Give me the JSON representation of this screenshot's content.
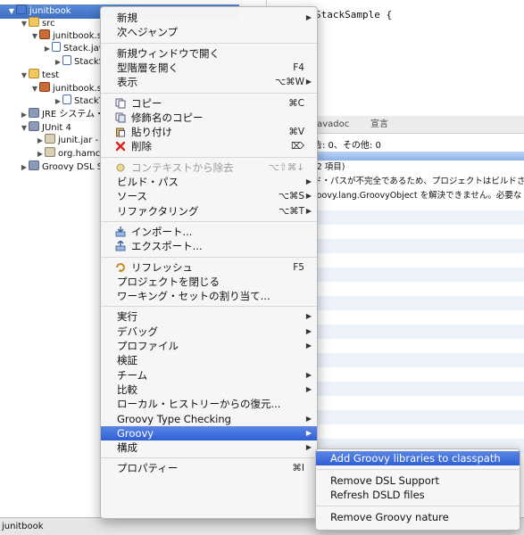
{
  "tree": [
    {
      "label": "junitbook",
      "icon": "project-icon",
      "twisty": "▼",
      "selected": true
    },
    {
      "label": "src",
      "icon": "source-folder-icon",
      "twisty": "▼"
    },
    {
      "label": "junitbook.s",
      "icon": "package-icon",
      "twisty": "▼"
    },
    {
      "label": "Stack.jav",
      "icon": "java-file-icon",
      "twisty": "▶"
    },
    {
      "label": "StackSar",
      "icon": "java-file-icon",
      "twisty": "▶"
    },
    {
      "label": "test",
      "icon": "source-folder-icon",
      "twisty": "▼"
    },
    {
      "label": "junitbook.s",
      "icon": "package-icon",
      "twisty": "▼"
    },
    {
      "label": "StackTe",
      "icon": "java-file-icon",
      "twisty": "▶"
    },
    {
      "label": "JRE システム・",
      "icon": "library-icon",
      "twisty": "▶"
    },
    {
      "label": "JUnit 4",
      "icon": "library-icon",
      "twisty": "▼"
    },
    {
      "label": "junit.jar - /",
      "icon": "jar-icon",
      "twisty": "▶"
    },
    {
      "label": "org.hamcre",
      "icon": "jar-icon",
      "twisty": "▶"
    },
    {
      "label": "Groovy DSL Su",
      "icon": "library-icon",
      "twisty": "▶"
    }
  ],
  "editor": {
    "code": "StackSample {"
  },
  "views": {
    "tabs": [
      "@ Javadoc",
      "宣言"
    ],
    "counts": "告: 0、その他: 0",
    "rows": [
      "(2 項目)",
      "ド・パスが不完全であるため、プロジェクトはビルドさ",
      "roovy.lang.GroovyObject を解決できません。必要な ."
    ]
  },
  "status": "junitbook",
  "context_menu": [
    {
      "type": "item",
      "label": "新規",
      "submenu": true
    },
    {
      "type": "item",
      "label": "次へジャンプ"
    },
    {
      "type": "sep"
    },
    {
      "type": "item",
      "label": "新規ウィンドウで開く"
    },
    {
      "type": "item",
      "label": "型階層を開く",
      "shortcut": "F4"
    },
    {
      "type": "item",
      "label": "表示",
      "shortcut": "⌥⌘W",
      "submenu": true
    },
    {
      "type": "sep"
    },
    {
      "type": "item",
      "label": "コピー",
      "shortcut": "⌘C",
      "icon": "copy-icon"
    },
    {
      "type": "item",
      "label": "修飾名のコピー",
      "icon": "copy-qualified-icon"
    },
    {
      "type": "item",
      "label": "貼り付け",
      "shortcut": "⌘V",
      "icon": "paste-icon"
    },
    {
      "type": "item",
      "label": "削除",
      "shortcut": "⌦",
      "icon": "delete-icon"
    },
    {
      "type": "sep"
    },
    {
      "type": "item",
      "label": "コンテキストから除去",
      "shortcut": "⌥⇧⌘↓",
      "icon": "remove-context-icon",
      "disabled": true
    },
    {
      "type": "item",
      "label": "ビルド・パス",
      "submenu": true
    },
    {
      "type": "item",
      "label": "ソース",
      "shortcut": "⌥⌘S",
      "submenu": true
    },
    {
      "type": "item",
      "label": "リファクタリング",
      "shortcut": "⌥⌘T",
      "submenu": true
    },
    {
      "type": "sep"
    },
    {
      "type": "item",
      "label": "インポート...",
      "icon": "import-icon"
    },
    {
      "type": "item",
      "label": "エクスポート...",
      "icon": "export-icon"
    },
    {
      "type": "sep"
    },
    {
      "type": "item",
      "label": "リフレッシュ",
      "shortcut": "F5",
      "icon": "refresh-icon"
    },
    {
      "type": "item",
      "label": "プロジェクトを閉じる"
    },
    {
      "type": "item",
      "label": "ワーキング・セットの割り当て..."
    },
    {
      "type": "sep"
    },
    {
      "type": "item",
      "label": "実行",
      "submenu": true
    },
    {
      "type": "item",
      "label": "デバッグ",
      "submenu": true
    },
    {
      "type": "item",
      "label": "プロファイル",
      "submenu": true
    },
    {
      "type": "item",
      "label": "検証"
    },
    {
      "type": "item",
      "label": "チーム",
      "submenu": true
    },
    {
      "type": "item",
      "label": "比較",
      "submenu": true
    },
    {
      "type": "item",
      "label": "ローカル・ヒストリーからの復元..."
    },
    {
      "type": "item",
      "label": "Groovy Type Checking",
      "submenu": true
    },
    {
      "type": "item",
      "label": "Groovy",
      "submenu": true,
      "highlighted": true
    },
    {
      "type": "item",
      "label": "構成",
      "submenu": true
    },
    {
      "type": "sep"
    },
    {
      "type": "item",
      "label": "プロパティー",
      "shortcut": "⌘I"
    }
  ],
  "submenu": [
    {
      "type": "item",
      "label": "Add Groovy libraries to classpath",
      "highlighted": true
    },
    {
      "type": "sep"
    },
    {
      "type": "item",
      "label": "Remove DSL Support"
    },
    {
      "type": "item",
      "label": "Refresh DSLD files"
    },
    {
      "type": "sep"
    },
    {
      "type": "item",
      "label": "Remove Groovy nature"
    }
  ],
  "colors": {
    "selection": "#3d6fc2",
    "menu_highlight": "#2f5fd6"
  }
}
